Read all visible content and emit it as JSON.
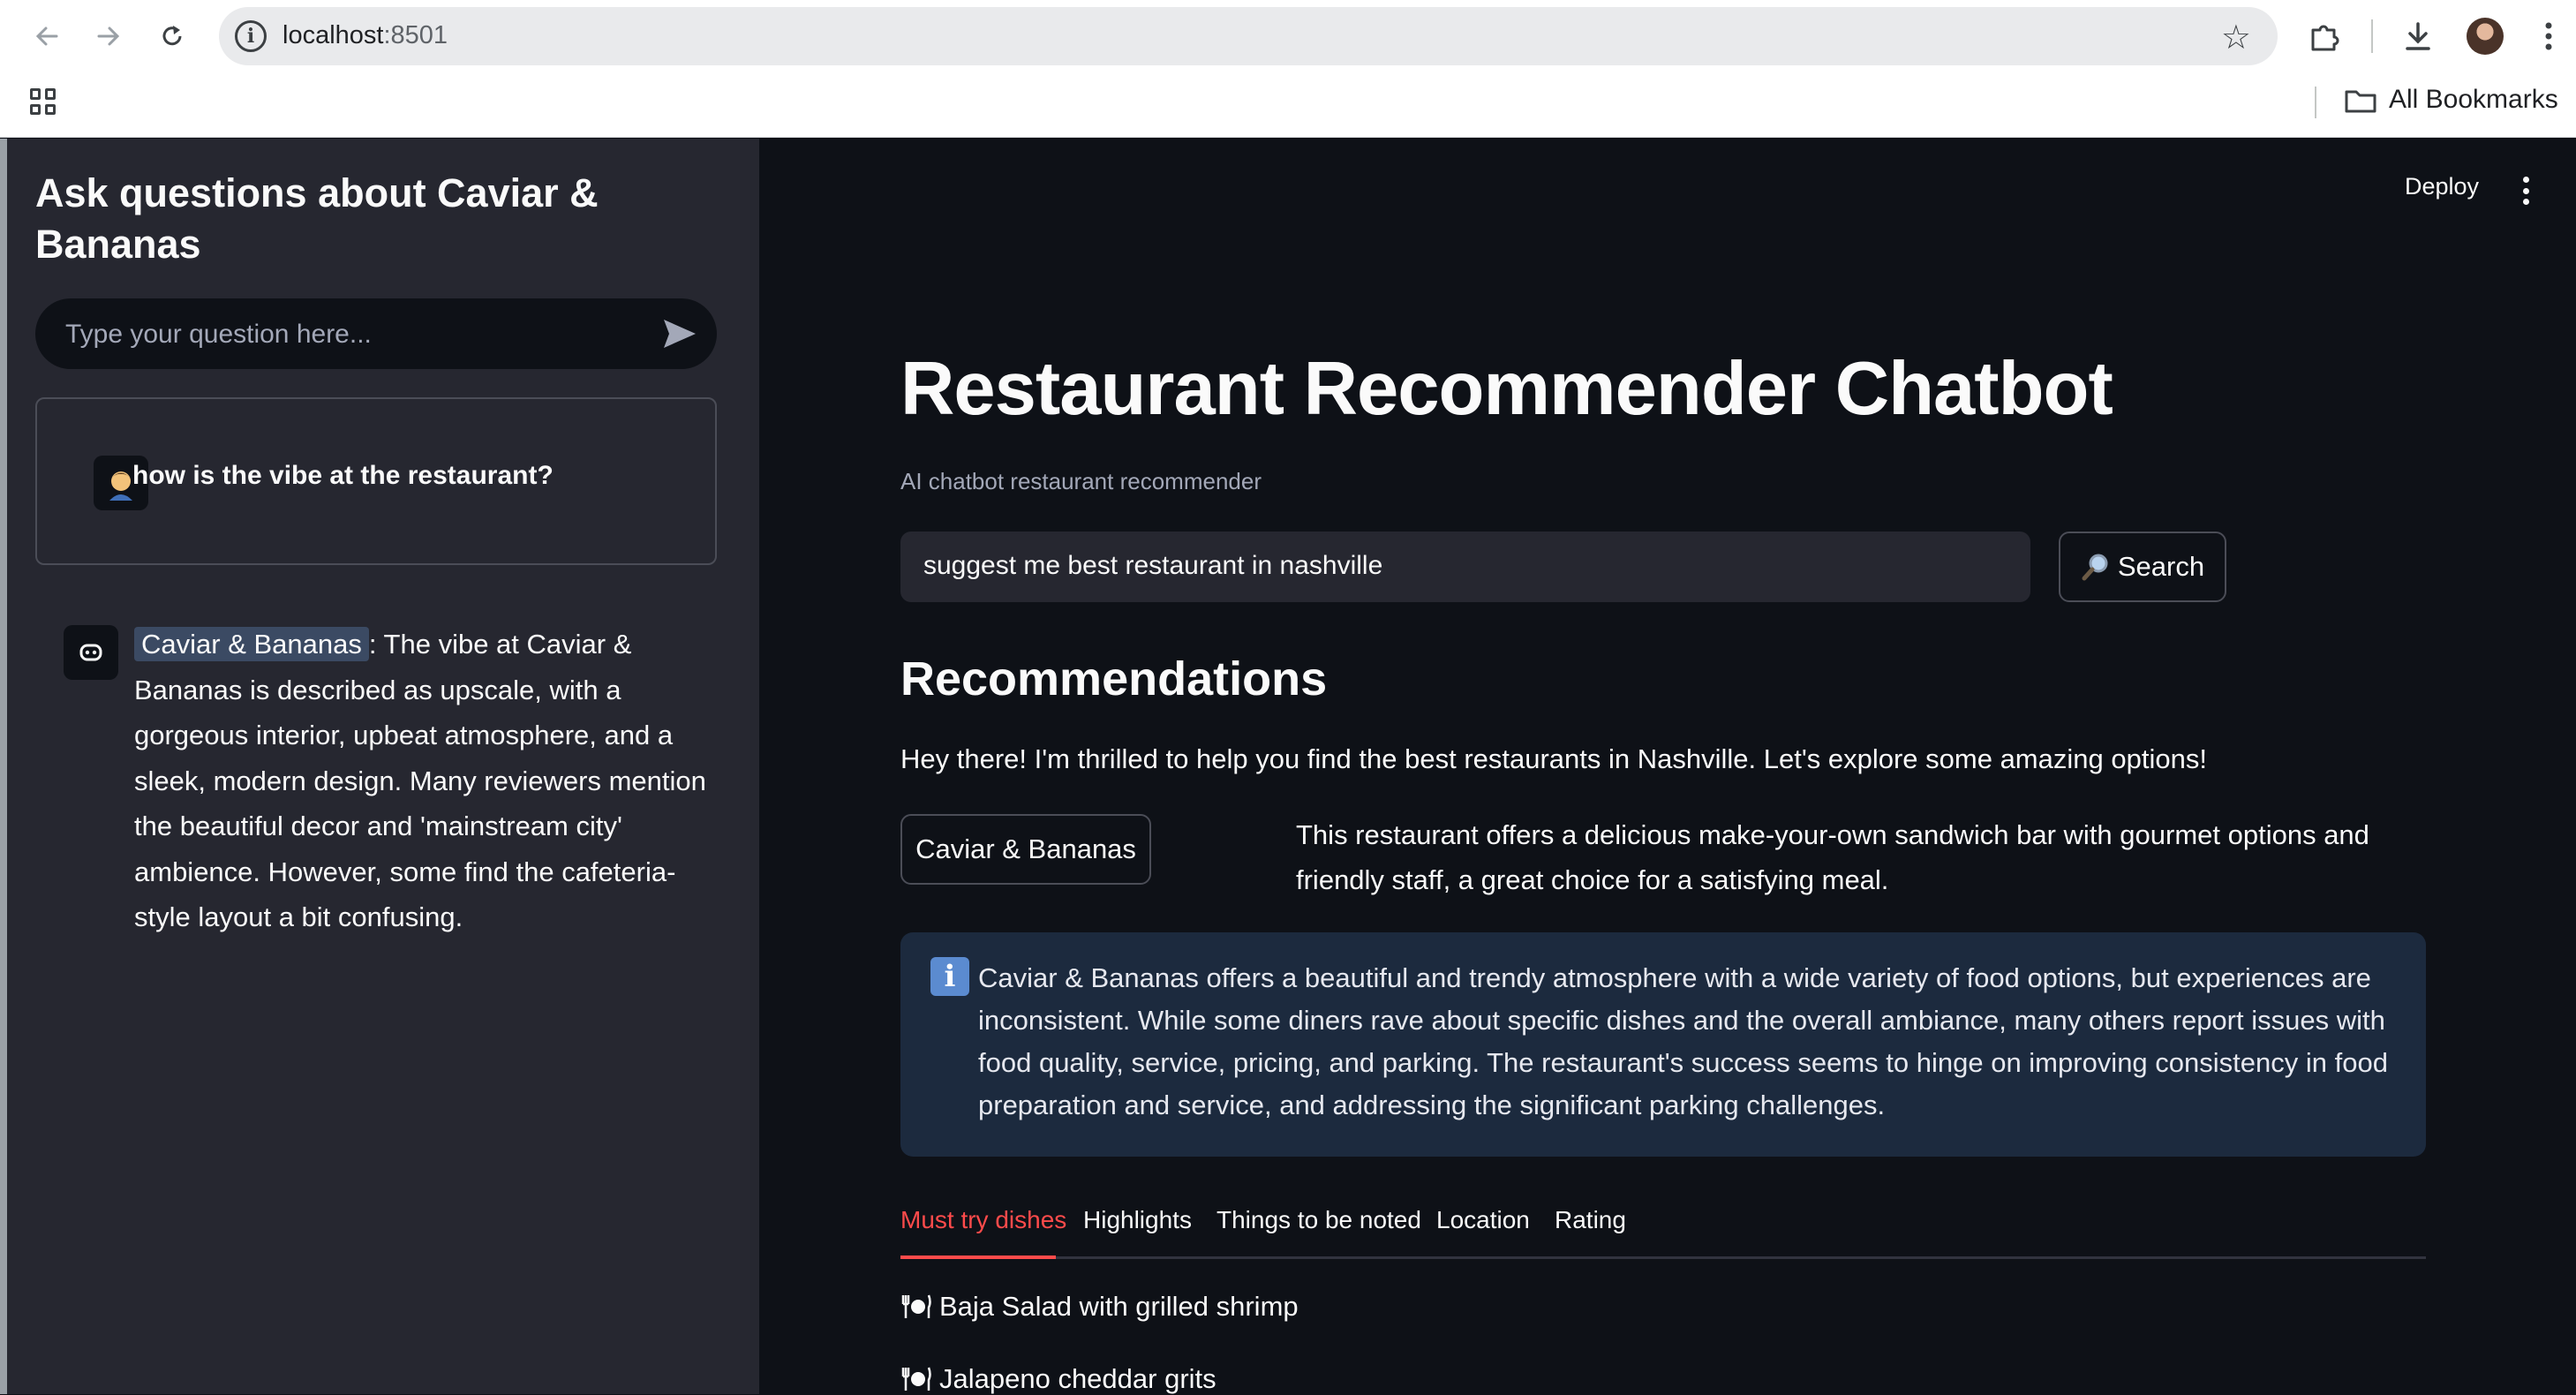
{
  "browser": {
    "url_host": "localhost",
    "url_port": ":8501",
    "bookmarks_label": "All Bookmarks"
  },
  "sidebar": {
    "title": "Ask questions about Caviar & Bananas",
    "chat_input_placeholder": "Type your question here...",
    "user_message": "how is the vibe at the restaurant?",
    "bot_message_highlight": "Caviar & Bananas",
    "bot_message_rest": ": The vibe at Caviar & Bananas is described as upscale, with a gorgeous interior, upbeat atmosphere, and a sleek, modern design. Many reviewers mention the beautiful decor and 'mainstream city' ambience. However, some find the cafeteria-style layout a bit confusing."
  },
  "header": {
    "deploy_label": "Deploy"
  },
  "main": {
    "title": "Restaurant Recommender Chatbot",
    "subtitle": "AI chatbot restaurant recommender",
    "query_value": "suggest me best restaurant in nashville",
    "search_button": "Search",
    "recommendations_heading": "Recommendations",
    "intro_text": "Hey there! I'm thrilled to help you find the best restaurants in Nashville. Let's explore some amazing options!",
    "restaurant_button": "Caviar & Bananas",
    "restaurant_description": "This restaurant offers a delicious make-your-own sandwich bar with gourmet options and friendly staff, a great choice for a satisfying meal.",
    "info_text": "Caviar & Bananas offers a beautiful and trendy atmosphere with a wide variety of food options, but experiences are inconsistent. While some diners rave about specific dishes and the overall ambiance, many others report issues with food quality, service, pricing, and parking. The restaurant's success seems to hinge on improving consistency in food preparation and service, and addressing the significant parking challenges.",
    "tabs": [
      "Must try dishes",
      "Highlights",
      "Things to be noted",
      "Location",
      "Rating"
    ],
    "active_tab": "Must try dishes",
    "dishes": [
      "Baja Salad with grilled shrimp",
      "Jalapeno cheddar grits"
    ]
  },
  "colors": {
    "accent": "#ff4b4b",
    "sidebar_bg": "#262730",
    "main_bg": "#0e1117",
    "info_bg": "#1c2a3e"
  },
  "icons": [
    "back-arrow-icon",
    "forward-arrow-icon",
    "reload-icon",
    "site-info-icon",
    "star-icon",
    "extensions-icon",
    "download-icon",
    "profile-avatar",
    "browser-menu-icon",
    "apps-grid-icon",
    "folder-icon",
    "send-icon",
    "user-avatar-icon",
    "bot-avatar-icon",
    "search-magnifier-icon",
    "info-icon",
    "plate-icon"
  ]
}
